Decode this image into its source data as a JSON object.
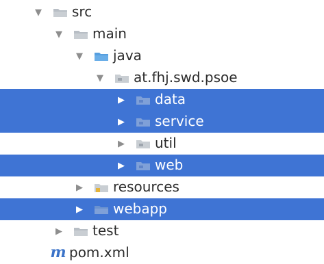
{
  "project_tree": {
    "nodes": [
      {
        "label": "src",
        "icon": "folder-icon",
        "arrow": "expanded",
        "selected": false
      },
      {
        "label": "main",
        "icon": "folder-icon",
        "arrow": "expanded",
        "selected": false
      },
      {
        "label": "java",
        "icon": "source-folder-icon",
        "arrow": "expanded",
        "selected": false
      },
      {
        "label": "at.fhj.swd.psoe",
        "icon": "package-icon",
        "arrow": "expanded",
        "selected": false
      },
      {
        "label": "data",
        "icon": "package-icon",
        "arrow": "collapsed",
        "selected": true
      },
      {
        "label": "service",
        "icon": "package-icon",
        "arrow": "collapsed",
        "selected": true
      },
      {
        "label": "util",
        "icon": "package-icon",
        "arrow": "collapsed",
        "selected": false
      },
      {
        "label": "web",
        "icon": "package-icon",
        "arrow": "collapsed",
        "selected": true
      },
      {
        "label": "resources",
        "icon": "resources-folder-icon",
        "arrow": "collapsed",
        "selected": false
      },
      {
        "label": "webapp",
        "icon": "folder-icon",
        "arrow": "collapsed",
        "selected": true
      },
      {
        "label": "test",
        "icon": "folder-icon",
        "arrow": "collapsed",
        "selected": false
      },
      {
        "label": "pom.xml",
        "icon": "maven-icon",
        "arrow": "none",
        "selected": false
      }
    ]
  },
  "icons": {
    "folder_color": "#c9ced3",
    "source_folder_color": "#6aaee8",
    "resources_accent": "#e4b33a",
    "maven_glyph": "m",
    "maven_color": "#3b73c8"
  },
  "colors": {
    "selection": "#3f74d4",
    "text": "#2b2b2b",
    "arrow": "#8e8e8e",
    "background": "#ffffff"
  }
}
